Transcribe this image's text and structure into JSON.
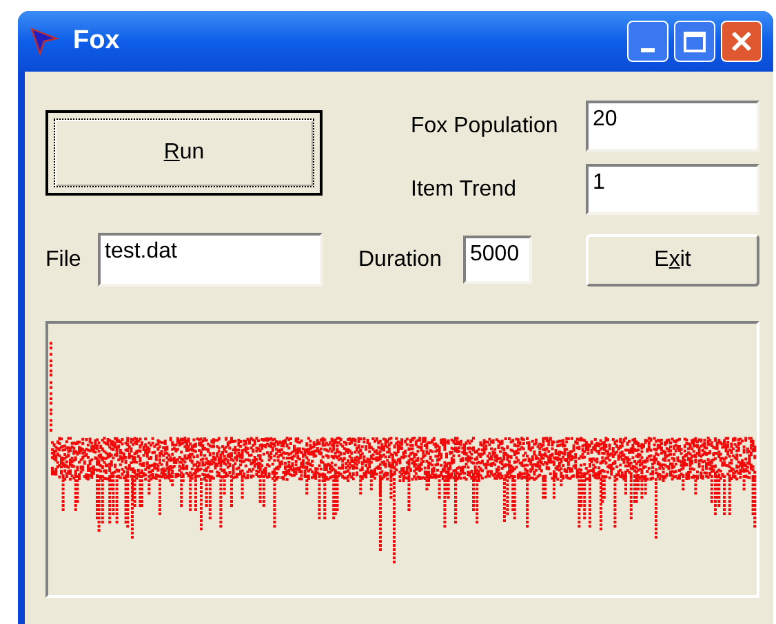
{
  "window": {
    "title": "Fox"
  },
  "run_button": {
    "access_key": "R",
    "label_after": "un"
  },
  "fields": [
    {
      "label": "Fox Population",
      "value": "20"
    },
    {
      "label": "Item Trend",
      "value": "1"
    }
  ],
  "file": {
    "label": "File",
    "value": "test.dat"
  },
  "duration": {
    "label": "Duration",
    "value": "5000"
  },
  "exit_button": {
    "label_before": "E",
    "access_key": "x",
    "label_after": "it"
  }
}
